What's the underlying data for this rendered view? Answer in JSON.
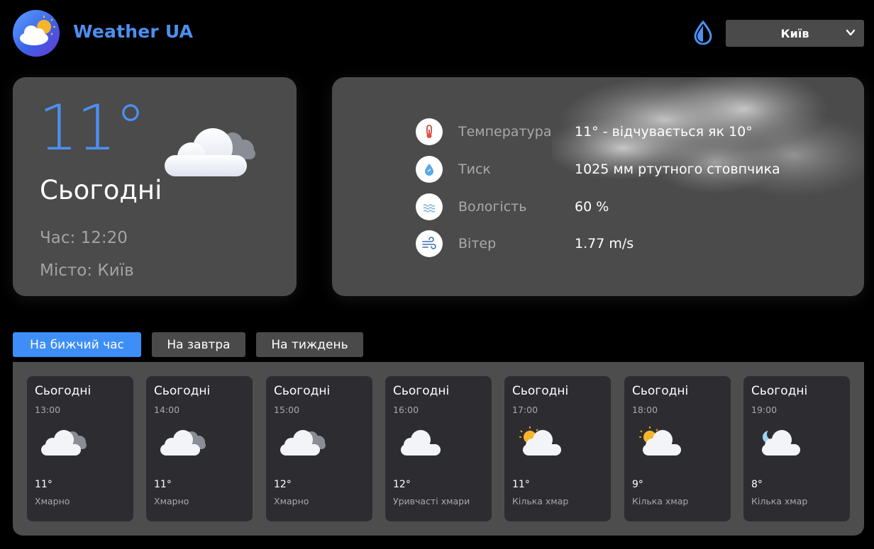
{
  "app": {
    "title": "Weather UA"
  },
  "header": {
    "city_selected": "Київ"
  },
  "current": {
    "temperature": "11°",
    "day": "Сьогодні",
    "time": "Час: 12:20",
    "city": "Місто: Київ",
    "icon": "cloudy-icon"
  },
  "details": [
    {
      "icon": "thermometer-icon",
      "label": "Температура",
      "value": "11° - відчувається як 10°"
    },
    {
      "icon": "pressure-icon",
      "label": "Тиск",
      "value": "1025 мм ртутного стовпчика"
    },
    {
      "icon": "humidity-icon",
      "label": "Вологість",
      "value": "60 %"
    },
    {
      "icon": "wind-icon",
      "label": "Вітер",
      "value": "1.77 m/s"
    }
  ],
  "tabs": [
    {
      "label": "На бижчий час",
      "active": true
    },
    {
      "label": "На завтра",
      "active": false
    },
    {
      "label": "На тиждень",
      "active": false
    }
  ],
  "forecast": [
    {
      "day": "Сьогодні",
      "time": "13:00",
      "temp": "11°",
      "desc": "Хмарно",
      "icon": "overcast-icon"
    },
    {
      "day": "Сьогодні",
      "time": "14:00",
      "temp": "11°",
      "desc": "Хмарно",
      "icon": "overcast-icon"
    },
    {
      "day": "Сьогодні",
      "time": "15:00",
      "temp": "12°",
      "desc": "Хмарно",
      "icon": "overcast-icon"
    },
    {
      "day": "Сьогодні",
      "time": "16:00",
      "temp": "12°",
      "desc": "Уривчасті хмари",
      "icon": "cloud-icon"
    },
    {
      "day": "Сьогодні",
      "time": "17:00",
      "temp": "11°",
      "desc": "Кілька хмар",
      "icon": "sun-cloud-icon"
    },
    {
      "day": "Сьогодні",
      "time": "18:00",
      "temp": "9°",
      "desc": "Кілька хмар",
      "icon": "sun-cloud-icon"
    },
    {
      "day": "Сьогодні",
      "time": "19:00",
      "temp": "8°",
      "desc": "Кілька хмар",
      "icon": "moon-cloud-icon"
    }
  ],
  "colors": {
    "accent": "#4d8ff0",
    "active_tab": "#3e8ef7",
    "card_bg": "#4b4b4b",
    "forecast_card_bg": "#2d2d31",
    "muted_text": "#a3a3a3"
  }
}
